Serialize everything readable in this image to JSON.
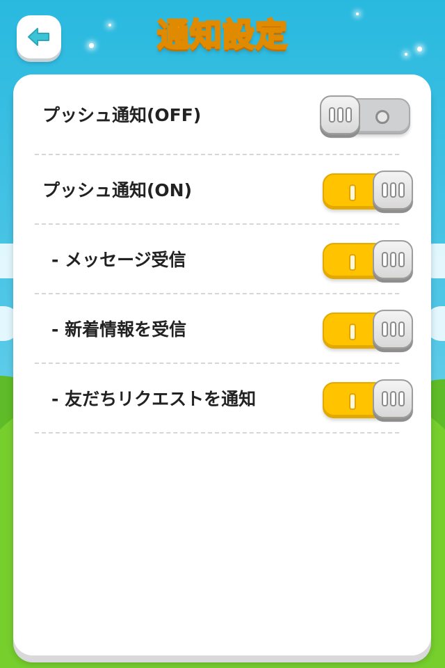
{
  "header": {
    "title": "通知設定"
  },
  "rows": [
    {
      "label": "プッシュ通知(OFF)",
      "state": "off"
    },
    {
      "label": "プッシュ通知(ON)",
      "state": "on"
    },
    {
      "label": "- メッセージ受信",
      "state": "on"
    },
    {
      "label": "- 新着情報を受信",
      "state": "on"
    },
    {
      "label": "- 友だちリクエストを通知",
      "state": "on"
    }
  ],
  "colors": {
    "accent_on": "#ffc300",
    "toggle_off": "#cfd0d2",
    "title": "#ffd23a",
    "sky": "#29b9df",
    "grass": "#77cf2e"
  },
  "icons": {
    "back": "back-arrow-icon"
  }
}
